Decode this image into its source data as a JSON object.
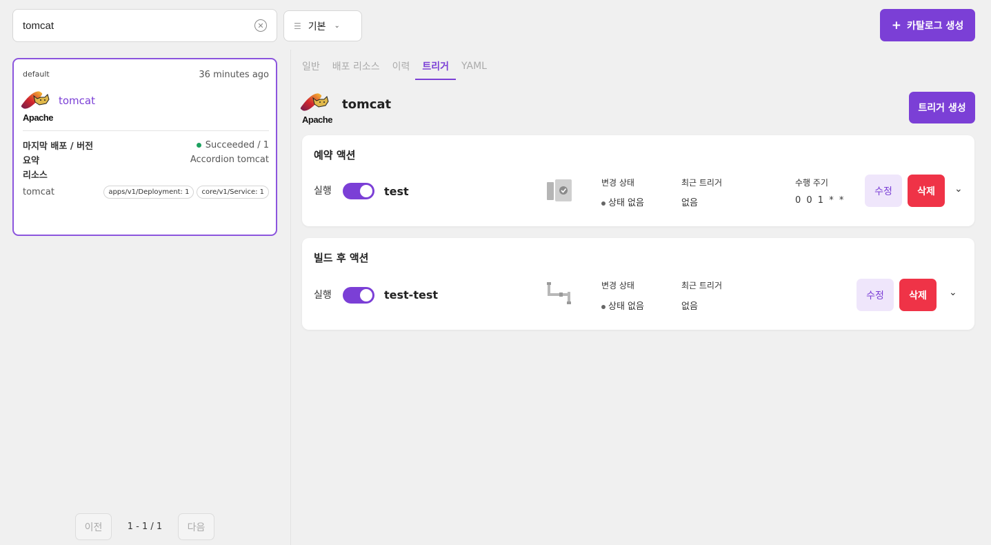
{
  "search": {
    "value": "tomcat"
  },
  "filter": {
    "label": "기본"
  },
  "buttons": {
    "create_catalog": "카탈로그 생성",
    "create_trigger": "트리거 생성"
  },
  "catalog": {
    "namespace": "default",
    "time": "36 minutes ago",
    "logo_text": "Apache",
    "name": "tomcat",
    "rows": {
      "deploy_key": "마지막 배포 / 버전",
      "deploy_val": "Succeeded / 1",
      "summary_key": "요약",
      "summary_val": "Accordion tomcat",
      "resource_key": "리소스"
    },
    "resource_name": "tomcat",
    "chips": [
      "apps/v1/Deployment: 1",
      "core/v1/Service: 1"
    ]
  },
  "pager": {
    "prev": "이전",
    "info": "1 - 1 / 1",
    "next": "다음"
  },
  "tabs": [
    "일반",
    "배포 리소스",
    "이력",
    "트리거",
    "YAML"
  ],
  "active_tab": "트리거",
  "app": {
    "name": "tomcat",
    "logo_text": "Apache"
  },
  "triggers": [
    {
      "title": "예약 액션",
      "exec_label": "실행",
      "name": "test",
      "change_label": "변경 상태",
      "change_value": "상태 없음",
      "recent_label": "최근 트리거",
      "recent_value": "없음",
      "cycle_label": "수행 주기",
      "cycle_value": "0 0 1 * *",
      "edit": "수정",
      "delete": "삭제"
    },
    {
      "title": "빌드 후 액션",
      "exec_label": "실행",
      "name": "test-test",
      "change_label": "변경 상태",
      "change_value": "상태 없음",
      "recent_label": "최근 트리거",
      "recent_value": "없음",
      "edit": "수정",
      "delete": "삭제"
    }
  ],
  "colors": {
    "accent": "#7b3fd6",
    "danger": "#ef3347",
    "success": "#1da15f"
  },
  "icons": {
    "clear": "clear-circle-icon",
    "filter": "sliders-icon",
    "plus": "plus-icon",
    "chevron": "chevron-down-icon"
  }
}
